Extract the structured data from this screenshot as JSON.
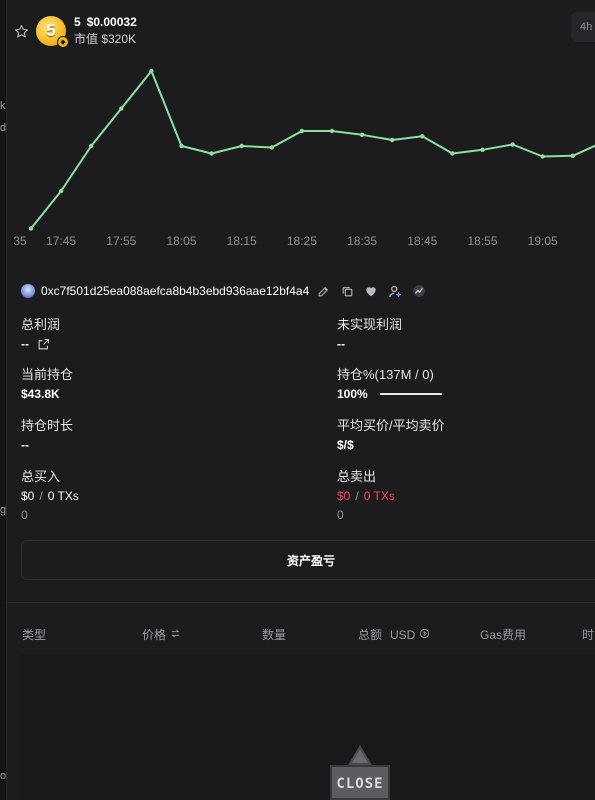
{
  "token": {
    "symbol": "5",
    "price": "$0.00032",
    "market_cap": "市值 $320K",
    "logo_text": "5"
  },
  "timeframe_button": "4h",
  "left_strip_marks": [
    "k",
    "d",
    "g",
    "o"
  ],
  "chart_data": {
    "type": "line",
    "x": [
      "17:40",
      "17:45",
      "17:50",
      "17:55",
      "18:00",
      "18:05",
      "18:10",
      "18:15",
      "18:20",
      "18:25",
      "18:30",
      "18:35",
      "18:40",
      "18:45",
      "18:50",
      "18:55",
      "19:00",
      "19:05",
      "19:10",
      "19:15"
    ],
    "tick_labels": [
      "35",
      "17:45",
      "17:55",
      "18:05",
      "18:15",
      "18:25",
      "18:35",
      "18:45",
      "18:55",
      "19:05"
    ],
    "series": [
      {
        "values": [
          0.00014,
          0.00019,
          0.00025,
          0.0003,
          0.00035,
          0.00025,
          0.00024,
          0.00025,
          0.000248,
          0.00027,
          0.00027,
          0.000265,
          0.000258,
          0.000263,
          0.00024,
          0.000245,
          0.000252,
          0.000236,
          0.000237,
          0.000255
        ],
        "color": "#8ce0a0"
      }
    ],
    "ylim": [
      0.00013,
      0.00037
    ],
    "grid": false,
    "line_color": "#8ce0a0"
  },
  "wallet": {
    "address": "0xc7f501d25ea088aefca8b4b3ebd936aae12bf4a4"
  },
  "stats": {
    "total_profit": {
      "label": "总利润",
      "value": "--"
    },
    "unrealized_profit": {
      "label": "未实现利润",
      "value": "--"
    },
    "current_holding": {
      "label": "当前持仓",
      "value": "$43.8K"
    },
    "holding_pct": {
      "label": "持仓%(137M / 0)",
      "value": "100%",
      "fill": 1.0
    },
    "holding_duration": {
      "label": "持仓时长",
      "value": "--"
    },
    "avg_price": {
      "label": "平均买价/平均卖价",
      "value": "$/$"
    },
    "total_buy": {
      "label": "总买入",
      "amount": "$0",
      "sep": "/",
      "txs": "0 TXs",
      "sub": "0"
    },
    "total_sell": {
      "label": "总卖出",
      "amount": "$0",
      "sep": "/",
      "txs": "0 TXs",
      "sub": "0"
    }
  },
  "pnl_button": "资产盈亏",
  "table": {
    "headers": {
      "type": "类型",
      "price": "价格",
      "quantity": "数量",
      "total": "总额",
      "unit": "USD",
      "gas": "Gas费用",
      "time": "时"
    }
  },
  "close_badge": "CLOSE",
  "colors": {
    "background": "#1c1c1f",
    "line": "#8ce0a0",
    "sell_red": "#f6465d"
  }
}
